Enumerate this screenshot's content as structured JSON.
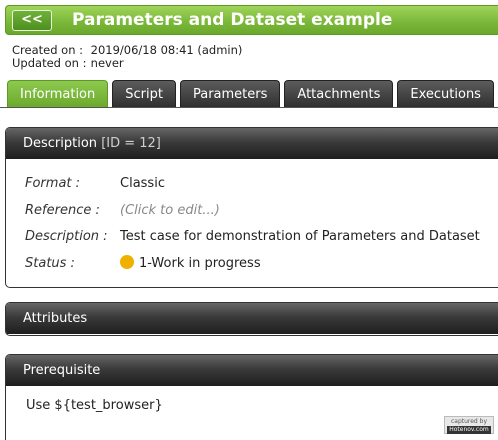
{
  "header": {
    "back_label": "<<",
    "title": "Parameters and Dataset example"
  },
  "meta": {
    "created_label": "Created on :",
    "created_value": "2019/06/18 08:41 (admin)",
    "updated_label": "Updated on :",
    "updated_value": "never"
  },
  "tabs": [
    {
      "label": "Information",
      "active": true
    },
    {
      "label": "Script"
    },
    {
      "label": "Parameters"
    },
    {
      "label": "Attachments"
    },
    {
      "label": "Executions"
    }
  ],
  "description": {
    "heading": "Description",
    "id_text": "[ID = 12]",
    "format_label": "Format :",
    "format_value": "Classic",
    "reference_label": "Reference :",
    "reference_placeholder": "(Click to edit...)",
    "description_label": "Description :",
    "description_value": "Test case for demonstration of Parameters and Dataset",
    "status_label": "Status :",
    "status_value": "1-Work in progress",
    "status_color": "#f0b000"
  },
  "attributes": {
    "heading": "Attributes"
  },
  "prerequisite": {
    "heading": "Prerequisite",
    "text": "Use ${test_browser}"
  },
  "watermark": {
    "line1": "captured by",
    "line2": "Hotenov.com"
  },
  "colors": {
    "accent_green": "#7cb93a",
    "panel_header_dark": "#2a2a2a"
  }
}
